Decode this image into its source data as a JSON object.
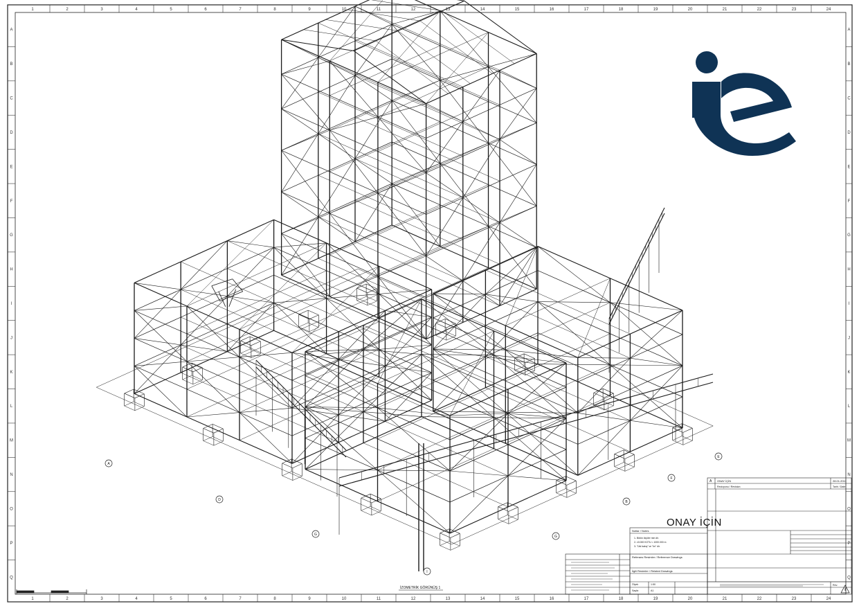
{
  "sheet": {
    "border_numbers": [
      "1",
      "2",
      "3",
      "4",
      "5",
      "6",
      "7",
      "8",
      "9",
      "10",
      "11",
      "12",
      "13",
      "14",
      "15",
      "16",
      "17",
      "18",
      "19",
      "20",
      "21",
      "22",
      "23",
      "24"
    ],
    "border_letters": [
      "A",
      "B",
      "C",
      "D",
      "E",
      "F",
      "G",
      "H",
      "I",
      "J",
      "K",
      "L",
      "M",
      "N",
      "O",
      "P",
      "Q"
    ],
    "logo": {
      "text": "ie",
      "color": "#0f3355"
    }
  },
  "drawing": {
    "grid_bubbles": [
      "A",
      "D",
      "G",
      "I",
      "E",
      "F",
      "B",
      "G"
    ],
    "view_caption": "İZOMETRİK GÖRÜNÜŞ 1"
  },
  "title_block": {
    "stamp": "ONAY İÇİN",
    "revision_letter": "A",
    "revision_text": "ONAY İÇİN",
    "revision_date": "28.01.2011",
    "revision_header_left": "Revizyonu / Revision",
    "revision_header_right": "Tarih / Date",
    "notes_title": "Notlar / Notes",
    "notes": [
      "1- Bütün ölçüler mm dir.",
      "2- ±0.000 KOTU = 1000.000 m",
      "3- \"Üst bakış\" ve \"ön\" dir."
    ],
    "reference_drawings": "Referans Resimler / Reference Drawings",
    "related_drawings": "İlgili Resimler / Related Drawings",
    "scale_label": "Ölçek",
    "scale_value": "1:50",
    "sheet_label": "Sayfa",
    "sheet_value": "A1",
    "warning_icon": "warning-triangle-icon",
    "rev_label": "Rev."
  }
}
